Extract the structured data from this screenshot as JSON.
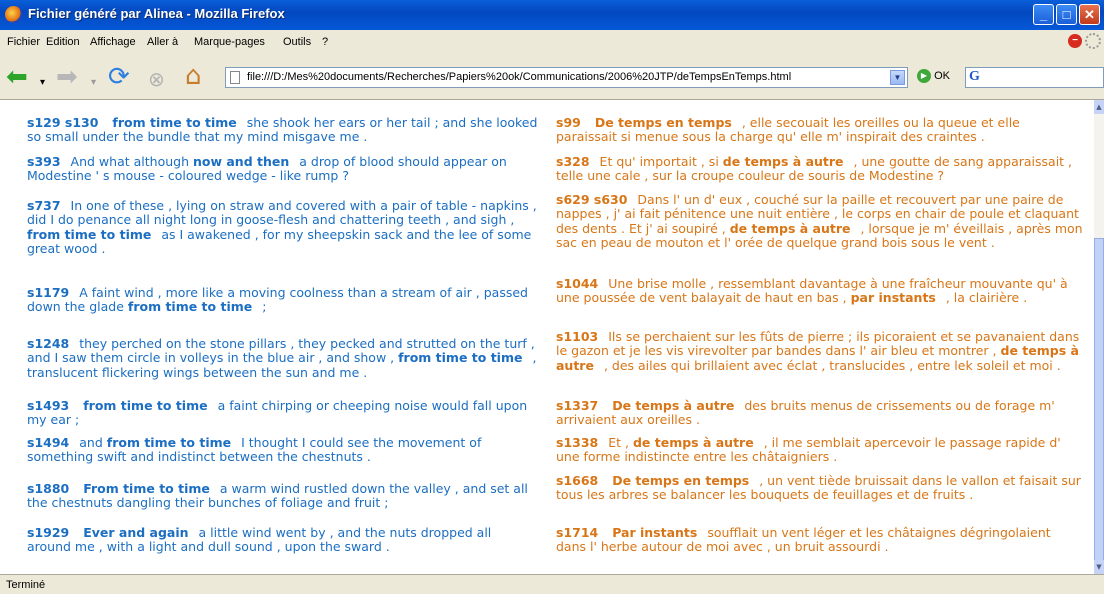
{
  "window": {
    "title": "Fichier généré par Alinea - Mozilla Firefox",
    "min": "_",
    "max": "□",
    "close": "✕"
  },
  "menu": [
    "Fichier",
    "Edition",
    "Affichage",
    "Aller à",
    "Marque-pages",
    "Outils",
    "?"
  ],
  "nav": {
    "url": "file:///D:/Mes%20documents/Recherches/Papiers%20ok/Communications/2006%20JTP/deTempsEnTemps.html",
    "go_label": "OK",
    "search_logo": "G"
  },
  "icons": [
    "firefox-icon",
    "back-icon",
    "forward-icon",
    "reload-icon",
    "stop-icon",
    "home-icon",
    "page-icon",
    "dropdown-arrow-icon",
    "go-icon",
    "google-icon",
    "throbber-icon"
  ],
  "rows": [
    {
      "en": {
        "ids": "s129 s130",
        "pre": "",
        "kw": "from time to time",
        "post": "she shook her ears or her tail ; and she looked so small under the bundle that my mind misgave me ."
      },
      "fr": {
        "ids": "s99",
        "pre": "",
        "kw": "De temps en temps",
        "post": ", elle secouait les oreilles ou la queue et elle paraissait si menue sous la charge qu' elle m' inspirait des craintes ."
      }
    },
    {
      "en": {
        "ids": "s393",
        "pre": "And what although",
        "kw": "now and then",
        "post": "a drop of blood should appear on Modestine ' s mouse - coloured wedge - like rump ?"
      },
      "fr": {
        "ids": "s328",
        "pre": "Et qu' importait , si",
        "kw": "de temps à autre",
        "post": ", une goutte de sang apparaissait , telle une cale , sur la croupe couleur de souris de Modestine ?"
      }
    },
    {
      "en": {
        "ids": "s737",
        "pre": "In one of these , lying on straw and covered with a pair of table - napkins , did I do penance all night long in goose-flesh and chattering teeth , and sigh ,",
        "kw": "from time to time",
        "post": "as I awakened , for my sheepskin sack and the lee of some great wood ."
      },
      "fr": {
        "ids": "s629 s630",
        "pre": "Dans l' un d' eux , couché sur la paille et recouvert par une paire de nappes , j' ai fait pénitence une nuit entière , le corps en chair de poule et claquant des dents . Et j' ai soupiré ,",
        "kw": "de temps à autre",
        "post": ", lorsque je m' éveillais , après mon sac en peau de mouton et l' orée de quelque grand bois sous le vent ."
      }
    },
    {
      "en": {
        "ids": "s1179",
        "pre": "A faint wind , more like a moving coolness than a stream of air , passed down the glade",
        "kw": "from time to time",
        "post": ";"
      },
      "fr": {
        "ids": "s1044",
        "pre": "Une brise molle , ressemblant davantage à une fraîcheur mouvante qu' à une poussée de vent balayait de haut en bas ,",
        "kw": "par instants",
        "post": ", la clairière ."
      }
    },
    {
      "en": {
        "ids": "s1248",
        "pre": "they perched on the stone pillars , they pecked and strutted on the turf , and I saw them circle in volleys in the blue air , and show ,",
        "kw": "from time to time",
        "post": ", translucent flickering wings between the sun and me ."
      },
      "fr": {
        "ids": "s1103",
        "pre": "Ils se perchaient sur les fûts de pierre ; ils picoraient et se pavanaient dans le gazon et je les vis virevolter par bandes dans l' air bleu et montrer ,",
        "kw": "de temps à autre",
        "post": ", des ailes qui brillaient avec éclat , translucides , entre lek soleil et moi ."
      }
    },
    {
      "en": {
        "ids": "s1493",
        "pre": "",
        "kw": "from time to time",
        "post": "a faint chirping or cheeping noise would fall upon my ear ;"
      },
      "fr": {
        "ids": "s1337",
        "pre": "",
        "kw": "De temps à autre",
        "post": "des bruits menus de crissements ou de forage m' arrivaient aux oreilles ."
      }
    },
    {
      "en": {
        "ids": "s1494",
        "pre": "and",
        "kw": "from time to time",
        "post": "I thought I could see the movement of something swift and indistinct between the chestnuts ."
      },
      "fr": {
        "ids": "s1338",
        "pre": "Et ,",
        "kw": "de temps à autre",
        "post": ", il me semblait apercevoir le passage rapide d' une forme indistincte entre les châtaigniers ."
      }
    },
    {
      "en": {
        "ids": "s1880",
        "pre": "",
        "kw": "From time to time",
        "post": "a warm wind rustled down the valley , and set all the chestnuts dangling their bunches of foliage and fruit ;"
      },
      "fr": {
        "ids": "s1668",
        "pre": "",
        "kw": "De temps en temps",
        "post": ", un vent tiède bruissait dans le vallon et faisait sur tous les arbres se balancer les bouquets de feuillages et de fruits ."
      }
    },
    {
      "en": {
        "ids": "s1929",
        "pre": "",
        "kw": "Ever and again",
        "post": "a little wind went by , and the nuts dropped all around me , with a light and dull sound , upon the sward ."
      },
      "fr": {
        "ids": "s1714",
        "pre": "",
        "kw": "Par instants",
        "post": "soufflait un vent léger et les châtaignes dégringolaient dans l' herbe autour de moi avec , un bruit assourdi ."
      }
    }
  ],
  "status": "Terminé"
}
